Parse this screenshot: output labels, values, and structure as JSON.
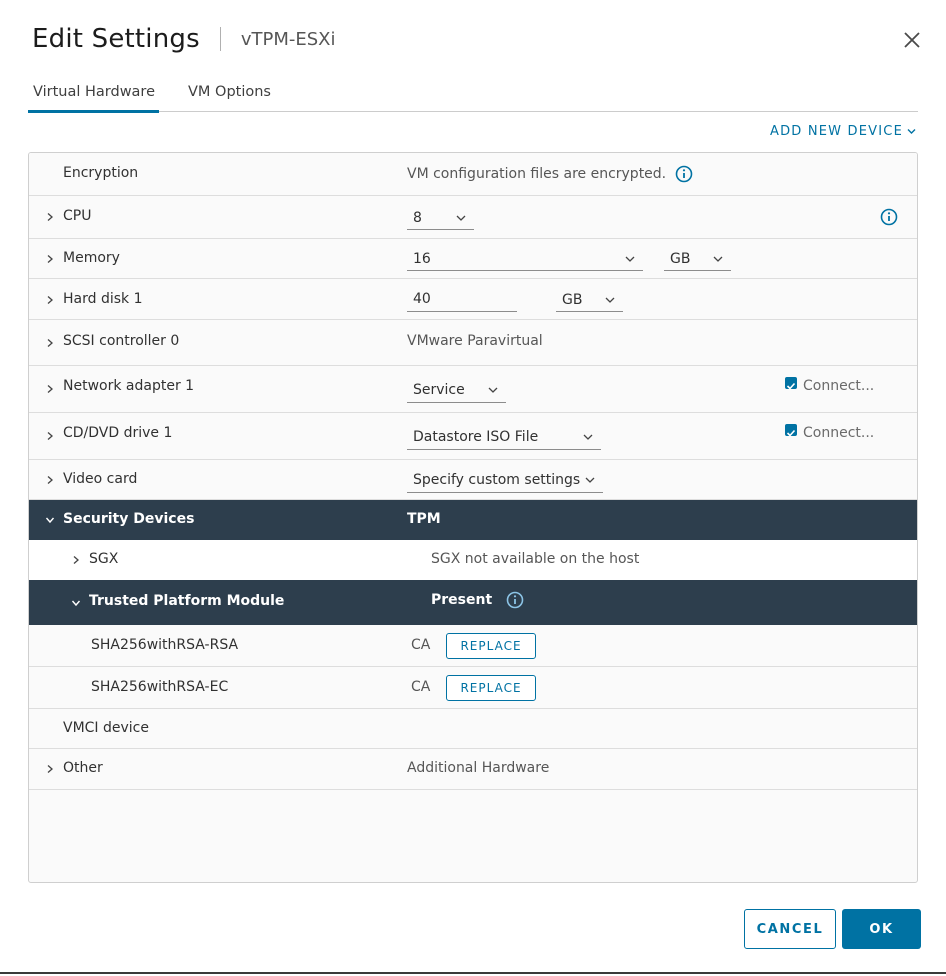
{
  "dialog": {
    "title": "Edit Settings",
    "subtitle": "vTPM-ESXi"
  },
  "tabs": [
    {
      "label": "Virtual Hardware",
      "active": true
    },
    {
      "label": "VM Options",
      "active": false
    }
  ],
  "add_device_label": "ADD NEW DEVICE",
  "rows": {
    "encryption": {
      "label": "Encryption",
      "value": "VM configuration files are encrypted."
    },
    "cpu": {
      "label": "CPU",
      "value": "8"
    },
    "memory": {
      "label": "Memory",
      "value": "16",
      "unit": "GB"
    },
    "hard_disk": {
      "label": "Hard disk 1",
      "value": "40",
      "unit": "GB"
    },
    "scsi": {
      "label": "SCSI controller 0",
      "value": "VMware Paravirtual"
    },
    "network": {
      "label": "Network adapter 1",
      "value": "Service",
      "connect_label": "Connect..."
    },
    "cdrom": {
      "label": "CD/DVD drive 1",
      "value": "Datastore ISO File",
      "connect_label": "Connect..."
    },
    "video": {
      "label": "Video card",
      "value": "Specify custom settings"
    },
    "security": {
      "label": "Security Devices",
      "value": "TPM"
    },
    "sgx": {
      "label": "SGX",
      "value": "SGX not available on the host"
    },
    "tpm": {
      "label": "Trusted Platform Module",
      "value": "Present"
    },
    "cert_rsa": {
      "label": "SHA256withRSA-RSA",
      "value": "CA",
      "button": "REPLACE"
    },
    "cert_ec": {
      "label": "SHA256withRSA-EC",
      "value": "CA",
      "button": "REPLACE"
    },
    "vmci": {
      "label": "VMCI device"
    },
    "other": {
      "label": "Other",
      "value": "Additional Hardware"
    }
  },
  "footer": {
    "cancel_label": "CANCEL",
    "ok_label": "OK"
  },
  "colors": {
    "accent": "#0072a3",
    "dark_row": "#2d3e4d"
  }
}
